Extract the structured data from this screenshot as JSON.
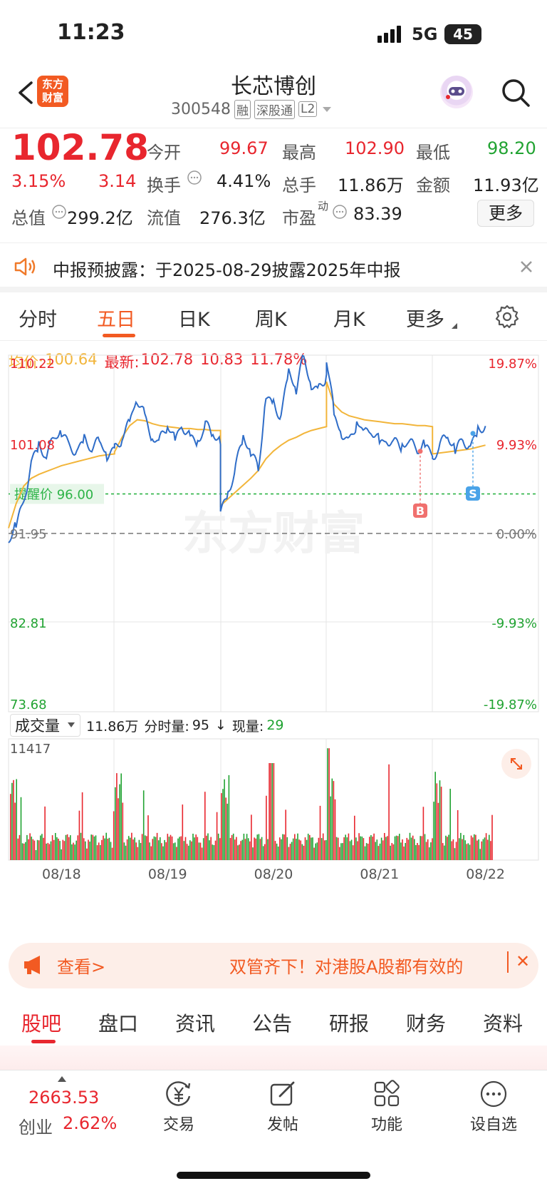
{
  "status_bar": {
    "time": "11:23",
    "network": "5G",
    "battery": "45"
  },
  "header": {
    "title": "长芯博创",
    "code": "300548",
    "tags": [
      "融",
      "深股通",
      "L2"
    ],
    "logo": "东方\n财富"
  },
  "quote": {
    "price": "102.78",
    "change_pct": "3.15%",
    "change": "3.14",
    "open_label": "今开",
    "open": "99.67",
    "high_label": "最高",
    "high": "102.90",
    "low_label": "最低",
    "low": "98.20",
    "turnover_label": "换手",
    "turnover": "4.41%",
    "volume_label": "总手",
    "volume": "11.86万",
    "amount_label": "金额",
    "amount": "11.93亿",
    "mcap_label": "总值",
    "mcap": "299.2亿",
    "float_label": "流值",
    "float": "276.3亿",
    "pe_label": "市盈",
    "pe_sup": "动",
    "pe": "83.39",
    "more_label": "更多"
  },
  "notice": {
    "text": "中报预披露：于2025-08-29披露2025年中报"
  },
  "tabs": [
    "分时",
    "五日",
    "日K",
    "周K",
    "月K",
    "更多"
  ],
  "active_tab": 1,
  "legend": {
    "avg_label": "均价:",
    "avg": "100.64",
    "latest_label": "最新:",
    "latest": "102.78",
    "change": "10.83",
    "pct": "11.78%"
  },
  "chart_data": {
    "type": "line",
    "y_ticks": [
      "110.22",
      "101.08",
      "91.95",
      "82.81",
      "73.68"
    ],
    "pct_ticks": [
      "19.87%",
      "9.93%",
      "0.00%",
      "-9.93%",
      "-19.87%"
    ],
    "x": [
      "08/18",
      "08/19",
      "08/20",
      "08/21",
      "08/22"
    ],
    "ylim": [
      73.68,
      110.22
    ],
    "prev_close": 91.95,
    "alert_label": "提醒价 96.00",
    "alert_price": 96.0,
    "markers": [
      "B",
      "S"
    ],
    "series": [
      {
        "values": [
          91.5,
          92.8,
          94.2,
          97.5,
          99.6,
          100.5,
          101.8,
          102.4,
          101.6,
          100.9,
          101.2,
          102.8,
          103.3,
          102.1,
          101.7,
          102.6,
          101.5,
          101.2,
          100.8,
          101.3,
          100.6,
          100.2,
          100.8
        ],
        "color": "#2f6dc8"
      },
      {
        "values": [
          92.0,
          93.8,
          95.6,
          96.7,
          97.4,
          97.9,
          98.1,
          98.3,
          98.4,
          98.6,
          98.7,
          98.8,
          98.9,
          99.0,
          99.1,
          99.1,
          99.2,
          99.3,
          99.3,
          99.4,
          99.5,
          99.6,
          99.7
        ],
        "color": "#f2b53a"
      }
    ],
    "volume_max": "11417"
  },
  "volume_bar": {
    "selector": "成交量",
    "total": "11.86万",
    "detail_label": "分时量:",
    "detail": "95",
    "now_label": "现量:",
    "now": "29"
  },
  "banner": {
    "left": "查看>",
    "right": "双管齐下！对港股A股都有效的",
    "close": "✕"
  },
  "bottom_tabs": [
    "股吧",
    "盘口",
    "资讯",
    "公告",
    "研报",
    "财务",
    "资料"
  ],
  "bottom_active": 0,
  "footer": {
    "index_value": "2663.53",
    "index_name": "创业",
    "index_pct": "2.62%",
    "items": [
      "交易",
      "发帖",
      "功能",
      "设自选"
    ]
  },
  "watermark": "东方财富"
}
